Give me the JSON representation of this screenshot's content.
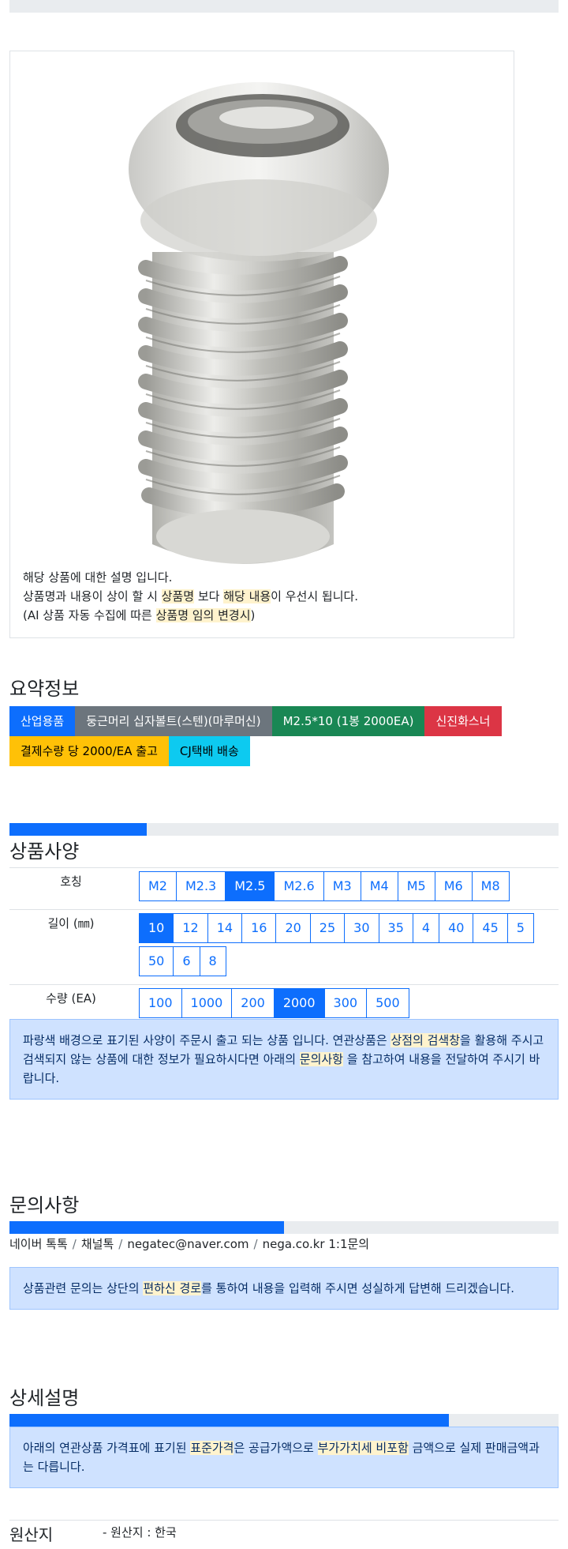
{
  "product_note": {
    "line1": "해당 상품에 대한 설명 입니다.",
    "line2_a": "상품명과 내용이 상이 할 시 ",
    "line2_hl1": "상품명",
    "line2_b": " 보다 ",
    "line2_hl2": "해당 내용",
    "line2_c": "이 우선시 됩니다.",
    "line3_a": "(AI 상품 자동 수집에 따른 ",
    "line3_hl": "상품명 임의 변경시",
    "line3_b": ")"
  },
  "summary": {
    "title": "요약정보",
    "tags_row1": [
      "산업용품",
      "둥근머리 십자볼트(스텐)(마루머신)",
      "M2.5*10 (1봉 2000EA)",
      "신진화스너"
    ],
    "tags_row2": [
      "결제수량 당 2000/EA 출고",
      "CJ택배 배송"
    ]
  },
  "spec": {
    "title": "상품사양",
    "progress_pct": 25,
    "rows": [
      {
        "label": "호칭",
        "options": [
          "M2",
          "M2.3",
          "M2.5",
          "M2.6",
          "M3",
          "M4",
          "M5",
          "M6",
          "M8"
        ],
        "active": "M2.5"
      },
      {
        "label": "길이 (㎜)",
        "options": [
          "10",
          "12",
          "14",
          "16",
          "20",
          "25",
          "30",
          "35",
          "4",
          "40",
          "45",
          "5",
          "50",
          "6",
          "8"
        ],
        "active": "10"
      },
      {
        "label": "수량 (EA)",
        "options": [
          "100",
          "1000",
          "200",
          "2000",
          "300",
          "500"
        ],
        "active": "2000"
      }
    ],
    "alert_a": "파랑색 배경으로 표기된 사양이 주문시 출고 되는 상품 입니다. 연관상품은 ",
    "alert_hl1": "상점의 검색창",
    "alert_b": "을 활용해 주시고 검색되지 않는 상품에 대한 정보가 필요하시다면 아래의 ",
    "alert_hl2": "문의사항",
    "alert_c": " 을 참고하여 내용을 전달하여 주시기 바랍니다."
  },
  "inquiry": {
    "title": "문의사항",
    "progress_pct": 50,
    "links": [
      "네이버 톡톡",
      "채널톡",
      "negatec@naver.com",
      "nega.co.kr 1:1문의"
    ],
    "separator": "/",
    "alert_a": "상품관련 문의는 상단의 ",
    "alert_hl": "편하신 경로",
    "alert_b": "를 통하여 내용을 입력해 주시면 성실하게 답변해 드리겠습니다."
  },
  "detail": {
    "title": "상세설명",
    "progress_pct": 80,
    "alert_a": "아래의 연관상품 가격표에 표기된 ",
    "alert_hl1": "표준가격",
    "alert_b": "은 공급가액으로 ",
    "alert_hl2": "부가가치세 비포함",
    "alert_c": " 금액으로 실제 판매금액과는 다릅니다."
  },
  "origin": {
    "label": "원산지",
    "value": "- 원산지 : 한국"
  },
  "colors": {
    "primary": "#0d6efd",
    "secondary": "#6c757d",
    "success": "#198754",
    "danger": "#dc3545",
    "warning": "#ffc107",
    "info": "#0dcaf0",
    "highlight": "#fff3cd",
    "alert_bg": "#cfe2ff"
  },
  "icons": {
    "product_image": "stainless-pan-head-phillips-screw-image"
  }
}
